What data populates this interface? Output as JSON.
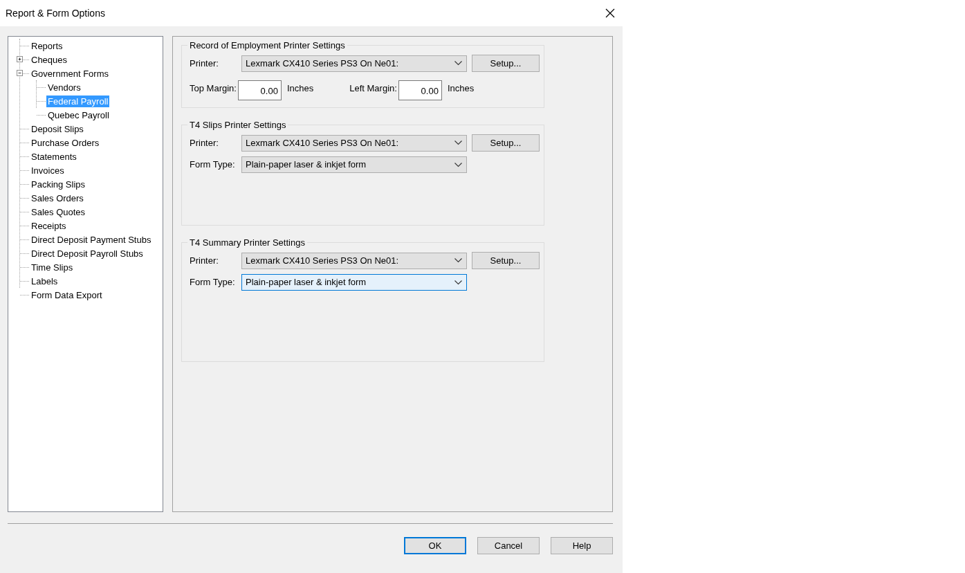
{
  "window": {
    "title": "Report & Form Options"
  },
  "tree": [
    {
      "label": "Reports",
      "kind": "leaf",
      "selected": false
    },
    {
      "label": "Cheques",
      "kind": "group",
      "expanded": false,
      "selected": false
    },
    {
      "label": "Government Forms",
      "kind": "group",
      "expanded": true,
      "selected": false,
      "children": [
        {
          "label": "Vendors",
          "kind": "leaf",
          "selected": false
        },
        {
          "label": "Federal Payroll",
          "kind": "leaf",
          "selected": true
        },
        {
          "label": "Quebec Payroll",
          "kind": "leaf",
          "selected": false
        }
      ]
    },
    {
      "label": "Deposit Slips",
      "kind": "leaf",
      "selected": false
    },
    {
      "label": "Purchase Orders",
      "kind": "leaf",
      "selected": false
    },
    {
      "label": "Statements",
      "kind": "leaf",
      "selected": false
    },
    {
      "label": "Invoices",
      "kind": "leaf",
      "selected": false
    },
    {
      "label": "Packing Slips",
      "kind": "leaf",
      "selected": false
    },
    {
      "label": "Sales Orders",
      "kind": "leaf",
      "selected": false
    },
    {
      "label": "Sales Quotes",
      "kind": "leaf",
      "selected": false
    },
    {
      "label": "Receipts",
      "kind": "leaf",
      "selected": false
    },
    {
      "label": "Direct Deposit Payment Stubs",
      "kind": "leaf",
      "selected": false
    },
    {
      "label": "Direct Deposit Payroll Stubs",
      "kind": "leaf",
      "selected": false
    },
    {
      "label": "Time Slips",
      "kind": "leaf",
      "selected": false
    },
    {
      "label": "Labels",
      "kind": "leaf",
      "selected": false
    },
    {
      "label": "Form Data Export",
      "kind": "leaf",
      "selected": false
    }
  ],
  "groups": [
    {
      "title": "Record of Employment Printer Settings",
      "printer_label": "Printer:",
      "printer": "Lexmark CX410 Series PS3 On Ne01:",
      "setup_button": "Setup...",
      "kind": "margins",
      "top_margin": {
        "label": "Top Margin:",
        "value": "0.00",
        "unit": "Inches"
      },
      "left_margin": {
        "label": "Left Margin:",
        "value": "0.00",
        "unit": "Inches"
      }
    },
    {
      "title": "T4 Slips Printer Settings",
      "printer_label": "Printer:",
      "printer": "Lexmark CX410 Series PS3 On Ne01:",
      "setup_button": "Setup...",
      "kind": "form_type",
      "form_type": {
        "label": "Form Type:",
        "value": "Plain-paper laser & inkjet form",
        "focused": false
      }
    },
    {
      "title": "T4 Summary Printer Settings",
      "printer_label": "Printer:",
      "printer": "Lexmark CX410 Series PS3 On Ne01:",
      "setup_button": "Setup...",
      "kind": "form_type",
      "form_type": {
        "label": "Form Type:",
        "value": "Plain-paper laser & inkjet form",
        "focused": true
      }
    }
  ],
  "buttons": [
    {
      "label": "OK",
      "default": true
    },
    {
      "label": "Cancel",
      "default": false
    },
    {
      "label": "Help",
      "default": false
    }
  ]
}
